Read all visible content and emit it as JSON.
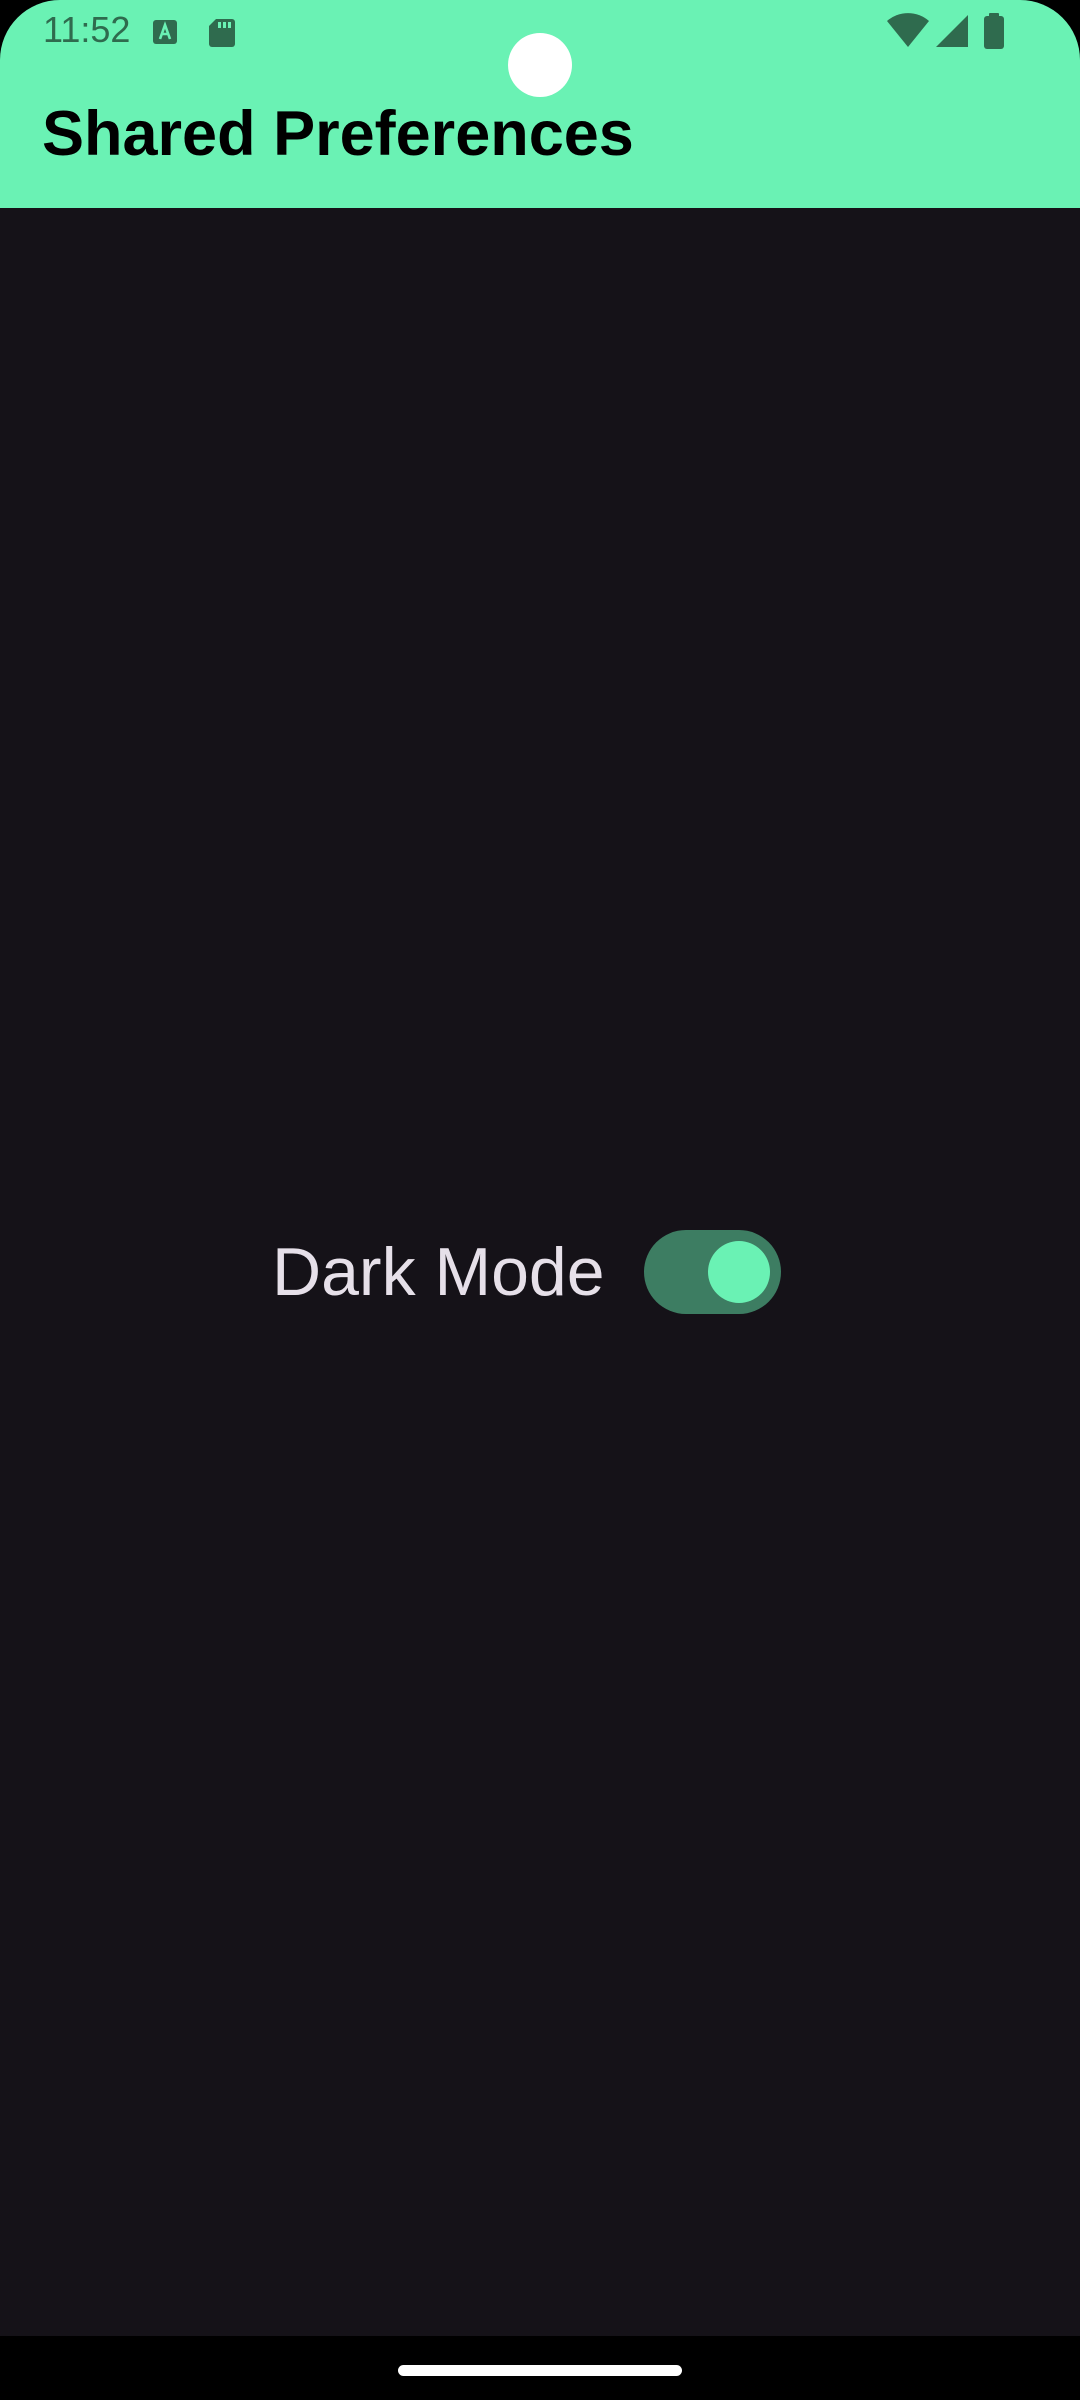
{
  "status_bar": {
    "time": "11:52",
    "left_icons": [
      "a-icon",
      "sd-card-icon"
    ],
    "right_icons": [
      "wifi-icon",
      "cell-signal-icon",
      "battery-icon"
    ]
  },
  "app_bar": {
    "title": "Shared Preferences"
  },
  "settings": {
    "dark_mode": {
      "label": "Dark Mode",
      "enabled": true
    }
  },
  "colors": {
    "accent": "#6af2b4",
    "background": "#151218",
    "toggle_track": "#3d7d62",
    "label_text": "#e6e0e9"
  }
}
